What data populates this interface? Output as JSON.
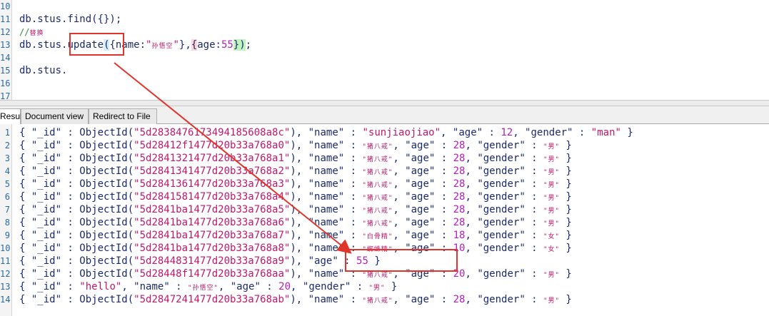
{
  "editor": {
    "lines": [
      {
        "num": "10",
        "tokens": []
      },
      {
        "num": "11",
        "tokens": [
          {
            "t": "db.stus.find({});",
            "c": "c-method"
          }
        ]
      },
      {
        "num": "12",
        "tokens": [
          {
            "t": "//",
            "c": "c-comment"
          },
          {
            "t": "替换",
            "c": "c-comment cjk"
          }
        ]
      },
      {
        "num": "13",
        "tokens": [
          {
            "t": "db.stus.",
            "c": "c-method"
          },
          {
            "t": "update",
            "c": "c-method"
          },
          {
            "t": "(",
            "c": "c-pb"
          },
          {
            "t": "{name:",
            "c": "c-method"
          },
          {
            "t": "\"",
            "c": "c-str"
          },
          {
            "t": "孙悟空",
            "c": "cjk"
          },
          {
            "t": "\"",
            "c": "c-str"
          },
          {
            "t": "},",
            "c": "c-method"
          },
          {
            "t": "{",
            "c": "c-ph"
          },
          {
            "t": "age:",
            "c": "c-method"
          },
          {
            "t": "55",
            "c": "c-num"
          },
          {
            "t": "}",
            "c": "c-pg"
          },
          {
            "t": ")",
            "c": "c-pg"
          },
          {
            "t": ";",
            "c": "c-method"
          }
        ]
      },
      {
        "num": "14",
        "tokens": []
      },
      {
        "num": "15",
        "tokens": [
          {
            "t": "db.stus.",
            "c": "c-method"
          }
        ]
      },
      {
        "num": "16",
        "tokens": []
      },
      {
        "num": "17",
        "tokens": []
      }
    ]
  },
  "tabs": [
    {
      "label": "Result",
      "active": true
    },
    {
      "label": "Document view",
      "active": false
    },
    {
      "label": "Redirect to File",
      "active": false
    }
  ],
  "result": {
    "rows": [
      {
        "num": "1",
        "id": "5d283847617349418 5608a8c",
        "tail": [
          {
            "t": ", \"name\" : ",
            "c": "k"
          },
          {
            "t": "\"sunjiaojiao\"",
            "c": "s"
          },
          {
            "t": ", \"age\" : ",
            "c": "k"
          },
          {
            "t": "12",
            "c": "n"
          },
          {
            "t": ", \"gender\" : ",
            "c": "k"
          },
          {
            "t": "\"man\"",
            "c": "s"
          },
          {
            "t": " }",
            "c": "k"
          }
        ]
      },
      {
        "num": "2",
        "id": "5d28412f1477d20b33a768a0",
        "tail": [
          {
            "t": ", \"name\" : ",
            "c": "k"
          },
          {
            "t": "\"猪八戒\"",
            "c": "s cjk"
          },
          {
            "t": ", \"age\" : ",
            "c": "k"
          },
          {
            "t": "28",
            "c": "n"
          },
          {
            "t": ", \"gender\" : ",
            "c": "k"
          },
          {
            "t": "\"男\"",
            "c": "s cjk"
          },
          {
            "t": " }",
            "c": "k"
          }
        ]
      },
      {
        "num": "3",
        "id": "5d2841321477d20b33a768a1",
        "tail": [
          {
            "t": ", \"name\" : ",
            "c": "k"
          },
          {
            "t": "\"猪八戒\"",
            "c": "s cjk"
          },
          {
            "t": ", \"age\" : ",
            "c": "k"
          },
          {
            "t": "28",
            "c": "n"
          },
          {
            "t": ", \"gender\" : ",
            "c": "k"
          },
          {
            "t": "\"男\"",
            "c": "s cjk"
          },
          {
            "t": " }",
            "c": "k"
          }
        ]
      },
      {
        "num": "4",
        "id": "5d2841341477d20b33a768a2",
        "tail": [
          {
            "t": ", \"name\" : ",
            "c": "k"
          },
          {
            "t": "\"猪八戒\"",
            "c": "s cjk"
          },
          {
            "t": ", \"age\" : ",
            "c": "k"
          },
          {
            "t": "28",
            "c": "n"
          },
          {
            "t": ", \"gender\" : ",
            "c": "k"
          },
          {
            "t": "\"男\"",
            "c": "s cjk"
          },
          {
            "t": " }",
            "c": "k"
          }
        ]
      },
      {
        "num": "5",
        "id": "5d2841361477d20b33a768a3",
        "tail": [
          {
            "t": ", \"name\" : ",
            "c": "k"
          },
          {
            "t": "\"猪八戒\"",
            "c": "s cjk"
          },
          {
            "t": ", \"age\" : ",
            "c": "k"
          },
          {
            "t": "28",
            "c": "n"
          },
          {
            "t": ", \"gender\" : ",
            "c": "k"
          },
          {
            "t": "\"男\"",
            "c": "s cjk"
          },
          {
            "t": " }",
            "c": "k"
          }
        ]
      },
      {
        "num": "6",
        "id": "5d2841581477d20b33a768a4",
        "tail": [
          {
            "t": ", \"name\" : ",
            "c": "k"
          },
          {
            "t": "\"猪八戒\"",
            "c": "s cjk"
          },
          {
            "t": ", \"age\" : ",
            "c": "k"
          },
          {
            "t": "28",
            "c": "n"
          },
          {
            "t": ", \"gender\" : ",
            "c": "k"
          },
          {
            "t": "\"男\"",
            "c": "s cjk"
          },
          {
            "t": " }",
            "c": "k"
          }
        ]
      },
      {
        "num": "7",
        "id": "5d2841ba1477d20b33a768a5",
        "tail": [
          {
            "t": ", \"name\" : ",
            "c": "k"
          },
          {
            "t": "\"猪八戒\"",
            "c": "s cjk"
          },
          {
            "t": ", \"age\" : ",
            "c": "k"
          },
          {
            "t": "28",
            "c": "n"
          },
          {
            "t": ", \"gender\" : ",
            "c": "k"
          },
          {
            "t": "\"男\"",
            "c": "s cjk"
          },
          {
            "t": " }",
            "c": "k"
          }
        ]
      },
      {
        "num": "8",
        "id": "5d2841ba1477d20b33a768a6",
        "tail": [
          {
            "t": ", \"name\" : ",
            "c": "k"
          },
          {
            "t": "\"猪八戒\"",
            "c": "s cjk"
          },
          {
            "t": ", \"age\" : ",
            "c": "k"
          },
          {
            "t": "28",
            "c": "n"
          },
          {
            "t": ", \"gender\" : ",
            "c": "k"
          },
          {
            "t": "\"男\"",
            "c": "s cjk"
          },
          {
            "t": " }",
            "c": "k"
          }
        ]
      },
      {
        "num": "9",
        "id": "5d2841ba1477d20b33a768a7",
        "tail": [
          {
            "t": ", \"name\" : ",
            "c": "k"
          },
          {
            "t": "\"白骨精\"",
            "c": "s cjk"
          },
          {
            "t": ", \"age\" : ",
            "c": "k"
          },
          {
            "t": "18",
            "c": "n"
          },
          {
            "t": ", \"gender\" : ",
            "c": "k"
          },
          {
            "t": "\"女\"",
            "c": "s cjk"
          },
          {
            "t": " }",
            "c": "k"
          }
        ]
      },
      {
        "num": "10",
        "id": "5d2841ba1477d20b33a768a8",
        "tail": [
          {
            "t": ", \"name\" : ",
            "c": "k"
          },
          {
            "t": "\"蜘蛛精\"",
            "c": "s cjk"
          },
          {
            "t": ", \"age\" : ",
            "c": "k"
          },
          {
            "t": "10",
            "c": "n"
          },
          {
            "t": ", \"gender\" : ",
            "c": "k"
          },
          {
            "t": "\"女\"",
            "c": "s cjk"
          },
          {
            "t": " }",
            "c": "k"
          }
        ]
      },
      {
        "num": "11",
        "id": "5d2844831477d20b33a768a9",
        "tail": [
          {
            "t": ", \"age\" : ",
            "c": "k"
          },
          {
            "t": "55",
            "c": "n"
          },
          {
            "t": " }",
            "c": "k"
          }
        ]
      },
      {
        "num": "12",
        "id": "5d28448f1477d20b33a768aa",
        "tail": [
          {
            "t": ", \"name\" : ",
            "c": "k"
          },
          {
            "t": "\"猪八戒\"",
            "c": "s cjk"
          },
          {
            "t": ", \"age\" : ",
            "c": "k"
          },
          {
            "t": "20",
            "c": "n"
          },
          {
            "t": ", \"gender\" : ",
            "c": "k"
          },
          {
            "t": "\"男\"",
            "c": "s cjk"
          },
          {
            "t": " }",
            "c": "k"
          }
        ]
      },
      {
        "num": "13",
        "plain": [
          {
            "t": "{ \"_id\" : ",
            "c": "k"
          },
          {
            "t": "\"hello\"",
            "c": "s"
          },
          {
            "t": ", \"name\" : ",
            "c": "k"
          },
          {
            "t": "\"孙悟空\"",
            "c": "s cjk"
          },
          {
            "t": ", \"age\" : ",
            "c": "k"
          },
          {
            "t": "20",
            "c": "n"
          },
          {
            "t": ", \"gender\" : ",
            "c": "k"
          },
          {
            "t": "\"男\"",
            "c": "s cjk"
          },
          {
            "t": " }",
            "c": "k"
          }
        ]
      },
      {
        "num": "14",
        "id": "5d2847241477d20b33a768ab",
        "tail": [
          {
            "t": ", \"name\" : ",
            "c": "k"
          },
          {
            "t": "\"猪八戒\"",
            "c": "s cjk"
          },
          {
            "t": ", \"age\" : ",
            "c": "k"
          },
          {
            "t": "28",
            "c": "n"
          },
          {
            "t": ", \"gender\" : ",
            "c": "k"
          },
          {
            "t": "\"男\"",
            "c": "s cjk"
          },
          {
            "t": " }",
            "c": "k"
          }
        ]
      }
    ]
  }
}
